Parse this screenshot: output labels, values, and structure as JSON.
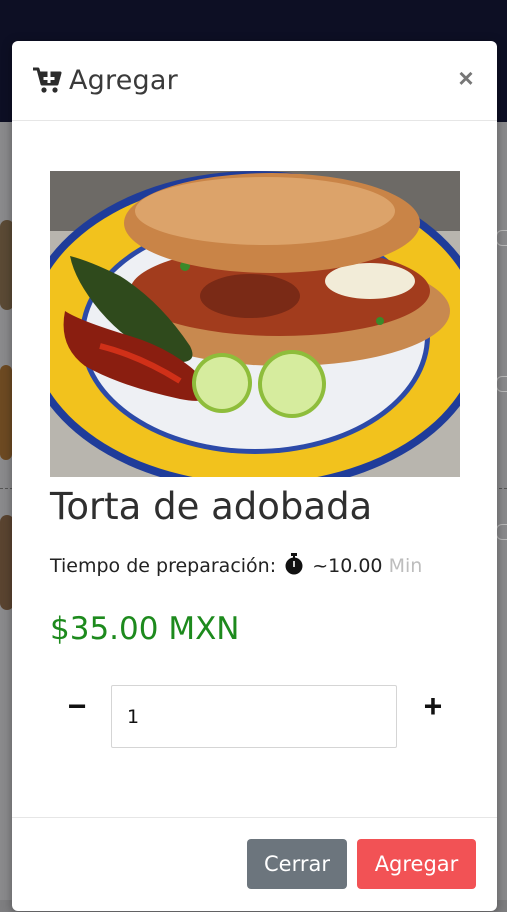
{
  "modal": {
    "title": "Agregar",
    "close_symbol": "×",
    "header_icon": "cart-plus-icon"
  },
  "product": {
    "name": "Torta de adobada",
    "prep_label": "Tiempo de preparación:",
    "prep_value": "~10.00",
    "prep_unit": "Min",
    "price": "$35.00 MXN",
    "image_alt": "Torta de adobada con chiles y limones"
  },
  "quantity": {
    "minus": "−",
    "value": "1",
    "plus": "+"
  },
  "footer": {
    "cancel_label": "Cerrar",
    "confirm_label": "Agregar"
  },
  "colors": {
    "price": "#1d8a1d",
    "cancel_button": "#6c757d",
    "confirm_button": "#f25255",
    "topbar": "#0d0f24"
  }
}
